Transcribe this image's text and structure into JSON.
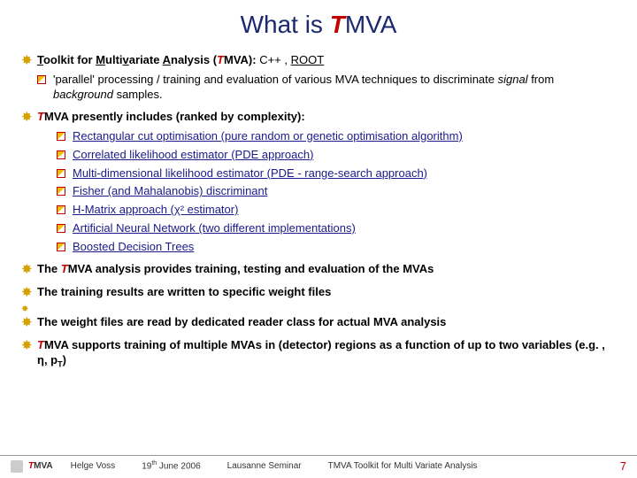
{
  "title": {
    "pre": "What is ",
    "t": "T",
    "post": "MVA"
  },
  "bullet1": {
    "main_pre": "T",
    "main_u1": "oolkit for ",
    "main_m": "M",
    "main_u2": "ulti",
    "main_v": "v",
    "main_u3": "ariate ",
    "main_a": "A",
    "main_u4": "nalysis (",
    "main_t": "T",
    "main_post": "MVA): ",
    "cpp": "C++ ",
    "comma": ", ",
    "root": "ROOT",
    "sub1_a": "'parallel' processing / training and evaluation of various MVA techniques to discriminate ",
    "sub1_b": "signal",
    "sub1_c": " from ",
    "sub1_d": "background",
    "sub1_e": " samples."
  },
  "bullet2": {
    "t": "T",
    "rest": "MVA presently includes (ranked by complexity):",
    "items": [
      "Rectangular cut optimisation (pure random or genetic optimisation algorithm)",
      "Correlated likelihood estimator (PDE approach)",
      "Multi-dimensional likelihood estimator (PDE - range-search approach)",
      "Fisher (and Mahalanobis) discriminant",
      "H-Matrix approach (χ² estimator)",
      "Artificial Neural Network (two different implementations)",
      "Boosted Decision Trees"
    ]
  },
  "bullet3": {
    "pre": "The ",
    "t": "T",
    "post": "MVA analysis provides training, testing and evaluation of the MVAs"
  },
  "bullet4": "The training results are written to specific weight files",
  "bullet5": "The weight files are read by dedicated reader class for actual MVA analysis",
  "bullet6": {
    "t": "T",
    "rest": "MVA supports training of multiple MVAs in (detector) regions as a function of up to two variables (e.g. , η, p",
    "sub": "T",
    "end": ")"
  },
  "footer": {
    "brand_t": "T",
    "brand_rest": "MVA",
    "author": "Helge Voss",
    "date_pre": "19",
    "date_sup": "th",
    "date_post": " June 2006",
    "event": "Lausanne Seminar",
    "desc": "TMVA Toolkit for Multi Variate Analysis",
    "page": "7"
  }
}
